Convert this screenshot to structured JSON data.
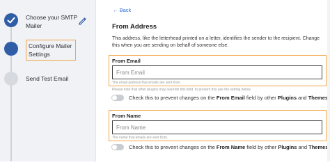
{
  "sidebar": {
    "steps": [
      {
        "label": "Choose your SMTP Mailer",
        "state": "done"
      },
      {
        "label": "Configure Mailer Settings",
        "state": "active"
      },
      {
        "label": "Send Test Email",
        "state": "todo"
      }
    ]
  },
  "main": {
    "back_label": "← Back",
    "section_title": "From Address",
    "section_description": "This address, like the letterhead printed on a letter, identifies the sender to the recipient. Change this when you are sending on behalf of someone else.",
    "from_email": {
      "label": "From Email",
      "placeholder": "From Email",
      "value": "",
      "hint": "The email address that emails are sent from."
    },
    "plugin_note": "Please note that other plugins may override this field, to prevent this use the setting below.",
    "email_toggle": {
      "prefix": "Check this to prevent changes on the ",
      "field": "From Email",
      "middle": " field by other ",
      "plugins": "Plugins",
      "and": " and ",
      "themes": "Themes",
      "checked": false
    },
    "from_name": {
      "label": "From Name",
      "placeholder": "From Name",
      "value": "",
      "hint": "The name that emails are sent from."
    },
    "name_toggle": {
      "prefix": "Check this to prevent changes on the ",
      "field": "From Name",
      "middle": " field by other ",
      "plugins": "Plugins",
      "and": " and ",
      "themes": "Themes",
      "checked": false
    }
  },
  "colors": {
    "accent": "#2f5ea7",
    "highlight": "#f0a542",
    "link": "#2f6ed1"
  }
}
